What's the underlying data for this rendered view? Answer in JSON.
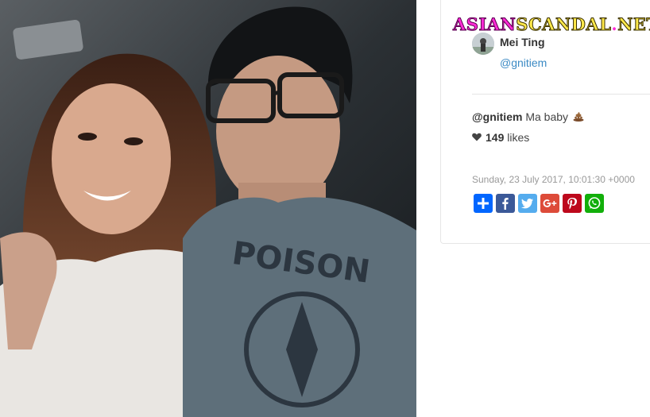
{
  "watermark": {
    "part1": "ASIAN",
    "part2": "SCANDAL",
    "dot": ".",
    "part3": "NET"
  },
  "photo": {
    "alt_icon": "selfie-photo"
  },
  "author": {
    "name": "Mei Ting",
    "handle": "@gnitiem"
  },
  "post": {
    "caption_handle": "@gnitiem",
    "caption_text": "Ma baby",
    "caption_emoji_icon": "poop-emoji-icon",
    "likes_count": "149",
    "likes_label": "likes",
    "timestamp": "Sunday, 23 July 2017, 10:01:30 +0000"
  },
  "share": {
    "buttons": [
      {
        "name": "share-generic-button",
        "icon": "plus-icon",
        "color": "#0166ff"
      },
      {
        "name": "share-facebook-button",
        "icon": "facebook-icon",
        "color": "#3b5998"
      },
      {
        "name": "share-twitter-button",
        "icon": "twitter-icon",
        "color": "#55acee"
      },
      {
        "name": "share-googleplus-button",
        "icon": "google-plus-icon",
        "color": "#dd4b39"
      },
      {
        "name": "share-pinterest-button",
        "icon": "pinterest-icon",
        "color": "#bd081c"
      },
      {
        "name": "share-whatsapp-button",
        "icon": "whatsapp-icon",
        "color": "#12af0a"
      }
    ]
  },
  "colors": {
    "link": "#3b8ac4",
    "text": "#444444",
    "muted": "#999999"
  }
}
